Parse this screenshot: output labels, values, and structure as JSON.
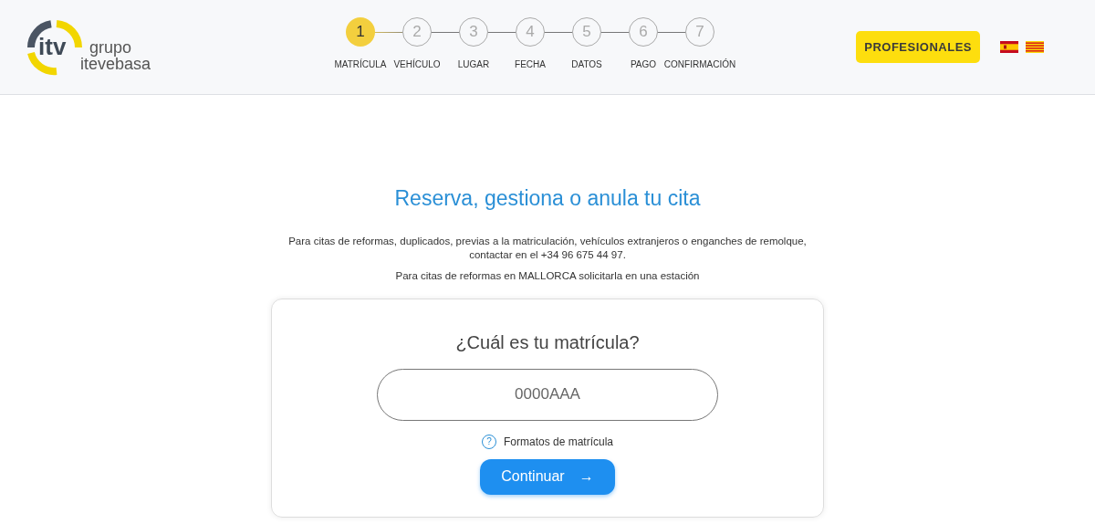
{
  "logo": {
    "mark": "itv",
    "line_1": "grupo",
    "line_2": "itevebasa"
  },
  "steps": [
    {
      "number": "1",
      "label": "MATRÍCULA",
      "selected": true
    },
    {
      "number": "2",
      "label": "VEHÍCULO",
      "selected": false
    },
    {
      "number": "3",
      "label": "LUGAR",
      "selected": false
    },
    {
      "number": "4",
      "label": "FECHA",
      "selected": false
    },
    {
      "number": "5",
      "label": "DATOS",
      "selected": false
    },
    {
      "number": "6",
      "label": "PAGO",
      "selected": false
    },
    {
      "number": "7",
      "label": "CONFIRMACIÓN",
      "selected": false
    }
  ],
  "professionals_button": "PROFESIONALES",
  "languages": [
    {
      "kind": "spain"
    },
    {
      "kind": "catalonia"
    }
  ],
  "title": "Reserva, gestiona o anula tu cita",
  "notes": [
    "Para citas de reformas, duplicados, previas a la matriculación, vehículos extranjeros o enganches de remolque, contactar en el +34 96 675 44 97.",
    "Para citas de reformas en MALLORCA solicitarla en una estación"
  ],
  "form": {
    "question": "¿Cuál es tu matrícula?",
    "placeholder": "0000AAA",
    "help_icon": "?",
    "help_link": "Formatos de matrícula",
    "submit": "Continuar",
    "submit_arrow": "→"
  }
}
